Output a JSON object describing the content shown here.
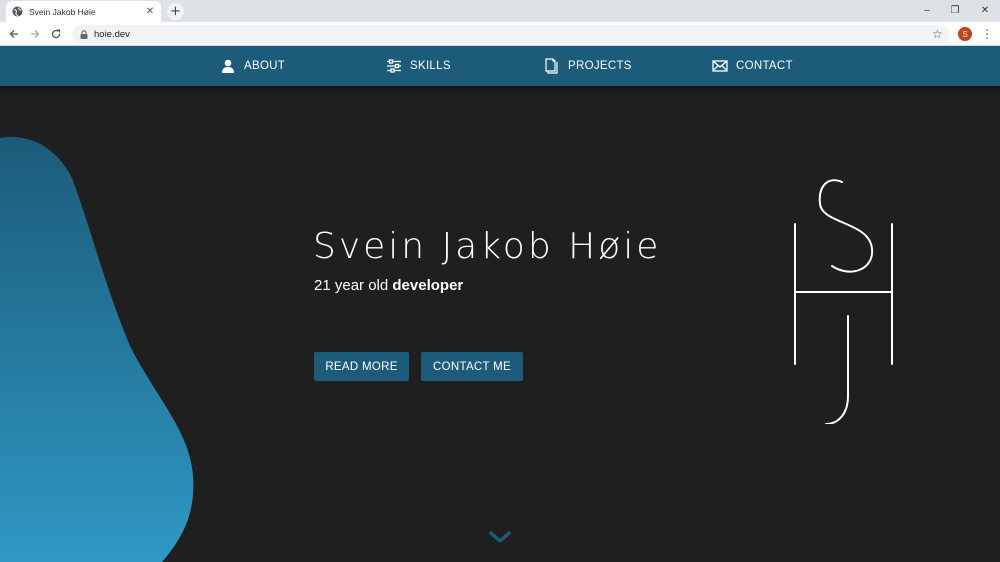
{
  "browser": {
    "tab_title": "Svein Jakob Høie",
    "tab_close": "✕",
    "new_tab": "+",
    "url": "hoie.dev",
    "profile_initial": "S",
    "window_controls": {
      "minimize": "–",
      "restore": "❐",
      "close": "✕"
    }
  },
  "nav": {
    "items": [
      {
        "label": "ABOUT",
        "icon": "user-icon"
      },
      {
        "label": "SKILLS",
        "icon": "sliders-icon"
      },
      {
        "label": "PROJECTS",
        "icon": "document-icon"
      },
      {
        "label": "CONTACT",
        "icon": "envelope-icon"
      }
    ]
  },
  "hero": {
    "name": "Svein Jakob Høie",
    "subtitle_prefix": "21 year old ",
    "subtitle_emphasis": "developer",
    "buttons": {
      "read_more": "READ MORE",
      "contact_me": "CONTACT ME"
    },
    "monogram_logo": "SHJ",
    "scroll_icon": "chevron-down-icon"
  },
  "colors": {
    "nav_bg": "#1c5b79",
    "hero_bg": "#1f1f1f",
    "blob_top": "#1c5b79",
    "blob_bottom": "#2f98c4",
    "text": "#ffffff"
  }
}
